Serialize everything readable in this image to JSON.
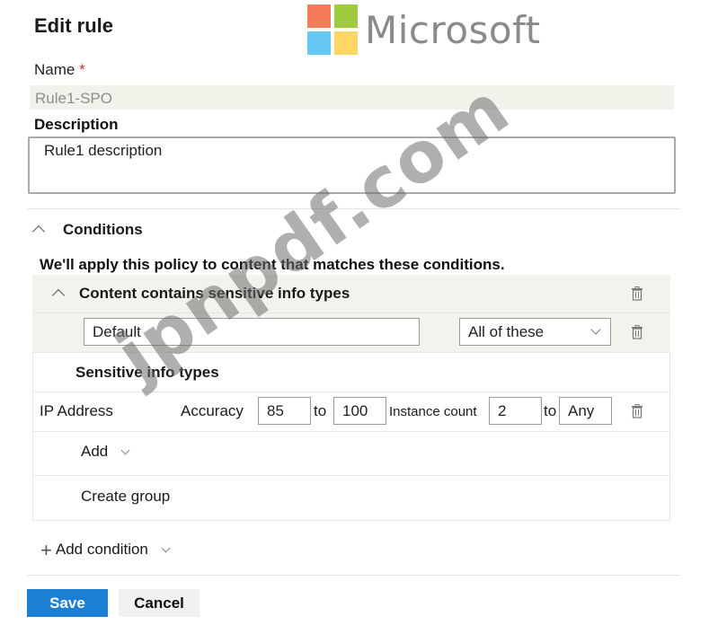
{
  "header": {
    "title": "Edit rule",
    "logo_text": "Microsoft",
    "logo_colors": [
      "#f25022",
      "#7fba00",
      "#00a4ef",
      "#ffb900"
    ]
  },
  "form": {
    "name_label": "Name",
    "name_required_mark": "*",
    "name_value": "Rule1-SPO",
    "description_label": "Description",
    "description_value": "Rule1 description"
  },
  "conditions": {
    "section_title": "Conditions",
    "intro": "We'll apply this policy to content that matches these conditions.",
    "group": {
      "title": "Content contains sensitive info types",
      "name_value": "Default",
      "match_option": "All of these",
      "sit_header": "Sensitive info types",
      "items": [
        {
          "name": "IP Address",
          "accuracy_label": "Accuracy",
          "accuracy_min": "85",
          "to_label": "to",
          "accuracy_max": "100",
          "instance_count_label": "Instance count",
          "instance_min": "2",
          "instance_max": "Any"
        }
      ],
      "add_label": "Add",
      "create_group_label": "Create group"
    },
    "add_condition_label": "Add condition"
  },
  "actions": {
    "save_label": "Save",
    "cancel_label": "Cancel",
    "save_color": "#1b80d4"
  },
  "watermark_text": "jpnpdf.com"
}
